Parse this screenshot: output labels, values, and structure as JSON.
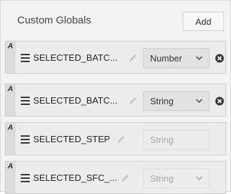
{
  "header": {
    "title": "Custom Globals",
    "add_label": "Add"
  },
  "rows": [
    {
      "badge": "A",
      "name": "SELECTED_BATC...",
      "type": "Number",
      "enabled": true,
      "removable": true
    },
    {
      "badge": "A",
      "name": "SELECTED_BATC...",
      "type": "String",
      "enabled": true,
      "removable": true
    },
    {
      "badge": "A",
      "name": "SELECTED_STEP",
      "type": "String",
      "enabled": false,
      "removable": false
    },
    {
      "badge": "A",
      "name": "SELECTED_SFC_...",
      "type": "String",
      "enabled": false,
      "removable": false
    }
  ],
  "icons": {
    "drag": "drag-handle-icon",
    "edit": "pencil-icon",
    "dropdown": "chevron-down-icon",
    "remove": "remove-circle-icon"
  },
  "colors": {
    "panel_bg": "#f3f3f3",
    "row_bg": "#ececec",
    "select_bg": "#e2e2e2",
    "disabled_text": "#a8a8a8"
  }
}
